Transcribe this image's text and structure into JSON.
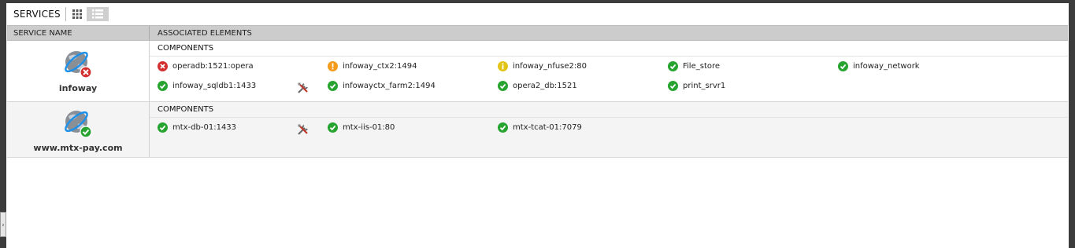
{
  "header": {
    "title": "SERVICES"
  },
  "view_buttons": {
    "grid": "grid-view-icon",
    "list": "list-view-icon",
    "active": "list"
  },
  "columns": {
    "service_name": "SERVICE NAME",
    "associated_elements": "ASSOCIATED ELEMENTS"
  },
  "status_colors": {
    "critical": "#d32f2f",
    "major": "#f59b1c",
    "info": "#e3c51a",
    "ok": "#27a32f"
  },
  "services": [
    {
      "name": "infoway",
      "status": "critical",
      "group_label": "COMPONENTS",
      "components": [
        {
          "name": "operadb:1521:opera",
          "status": "critical"
        },
        {
          "name": "infoway_ctx2:1494",
          "status": "major"
        },
        {
          "name": "infoway_nfuse2:80",
          "status": "info"
        },
        {
          "name": "File_store",
          "status": "ok"
        },
        {
          "name": "infoway_network",
          "status": "ok"
        },
        {
          "name": "infoway_sqldb1:1433",
          "status": "ok"
        },
        {
          "name": "infowayctx_farm2:1494",
          "status": "ok"
        },
        {
          "name": "opera2_db:1521",
          "status": "ok"
        },
        {
          "name": "print_srvr1",
          "status": "ok"
        }
      ]
    },
    {
      "name": "www.mtx-pay.com",
      "status": "ok",
      "group_label": "COMPONENTS",
      "components": [
        {
          "name": "mtx-db-01:1433",
          "status": "ok"
        },
        {
          "name": "mtx-iis-01:80",
          "status": "ok"
        },
        {
          "name": "mtx-tcat-01:7079",
          "status": "ok"
        }
      ]
    }
  ],
  "left_tab": {
    "label": "›"
  }
}
